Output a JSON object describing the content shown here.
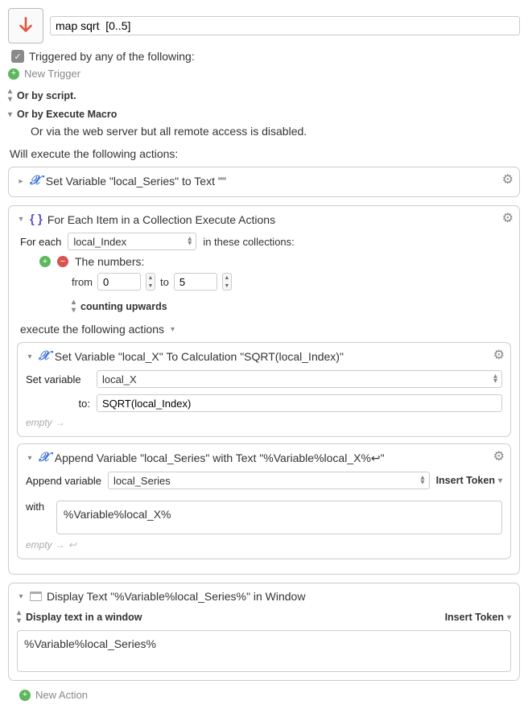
{
  "header": {
    "title": "map sqrt  [0..5]"
  },
  "triggers": {
    "heading": "Triggered by any of the following:",
    "new_trigger": "New Trigger",
    "or_script": "Or by script.",
    "or_execute": "Or by Execute Macro",
    "or_web": "Or via the web server but all remote access is disabled."
  },
  "actions_lead": "Will execute the following actions:",
  "action_setvar_initial": {
    "title": "Set Variable \"local_Series\" to Text \"\""
  },
  "foreach": {
    "title": "For Each Item in a Collection Execute Actions",
    "for_each_label": "For each",
    "for_each_var": "local_Index",
    "in_collections": "in these collections:",
    "numbers_label": "The numbers:",
    "from_label": "from",
    "from_value": "0",
    "to_label": "to",
    "to_value": "5",
    "counting": "counting upwards",
    "execute_label": "execute the following actions",
    "calc": {
      "title": "Set Variable \"local_X\" To Calculation \"SQRT(local_Index)\"",
      "set_var_label": "Set variable",
      "set_var_value": "local_X",
      "to_label": "to:",
      "to_value": "SQRT(local_Index)",
      "empty": "empty"
    },
    "append": {
      "title": "Append Variable \"local_Series\" with Text \"%Variable%local_X%↩\"",
      "append_label": "Append variable",
      "append_var": "local_Series",
      "insert_token": "Insert Token",
      "with_label": "with",
      "with_value": "%Variable%local_X%",
      "empty": "empty"
    }
  },
  "display": {
    "title": "Display Text \"%Variable%local_Series%\" in Window",
    "mode": "Display text in a window",
    "insert_token": "Insert Token",
    "body": "%Variable%local_Series%"
  },
  "new_action": "New Action"
}
